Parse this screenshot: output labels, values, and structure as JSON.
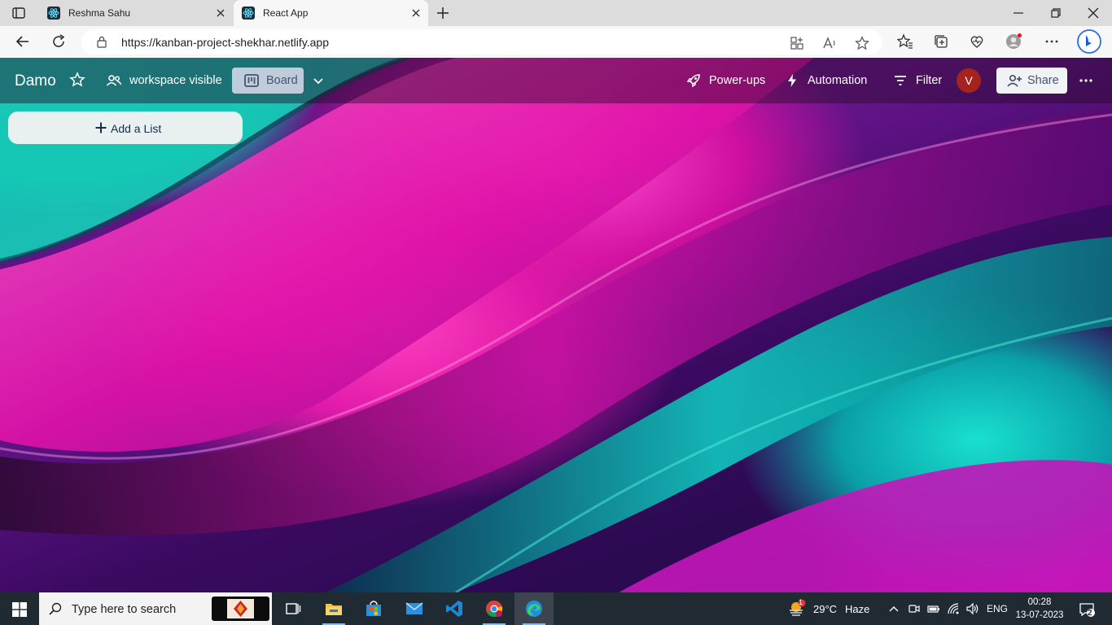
{
  "browser": {
    "tabs": [
      {
        "title": "Reshma Sahu",
        "active": false
      },
      {
        "title": "React App",
        "active": true
      }
    ],
    "url": "https://kanban-project-shekhar.netlify.app"
  },
  "board": {
    "title": "Damo",
    "visibility_label": "workspace visible",
    "view_label": "Board",
    "powerups_label": "Power-ups",
    "automation_label": "Automation",
    "filter_label": "Filter",
    "avatar_initial": "V",
    "share_label": "Share",
    "add_list_label": "Add a List"
  },
  "taskbar": {
    "search_placeholder": "Type here to search",
    "weather_temp": "29°C",
    "weather_desc": "Haze",
    "weather_badge": "1",
    "language": "ENG",
    "time": "00:28",
    "date": "13-07-2023",
    "notification_count": "2"
  },
  "colors": {
    "avatar_bg": "#a5231e",
    "taskbar_bg": "#1f2a33",
    "add_list_bg": "#e9f0f0"
  }
}
